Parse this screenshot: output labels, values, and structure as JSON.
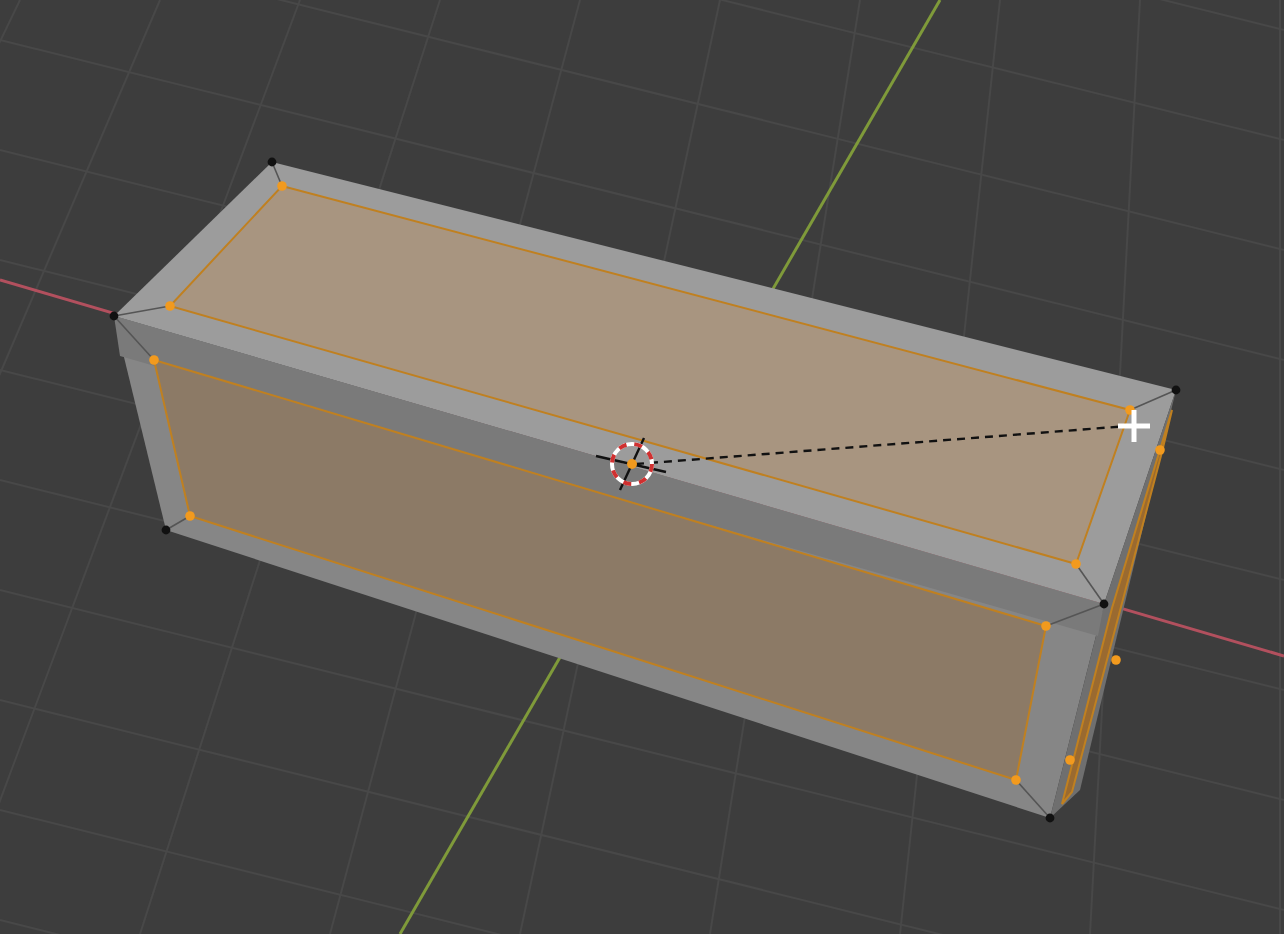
{
  "object": {
    "faces": [
      {
        "kind": "top",
        "selected": true
      },
      {
        "kind": "front",
        "selected": true
      },
      {
        "kind": "side",
        "selected": true
      }
    ]
  }
}
